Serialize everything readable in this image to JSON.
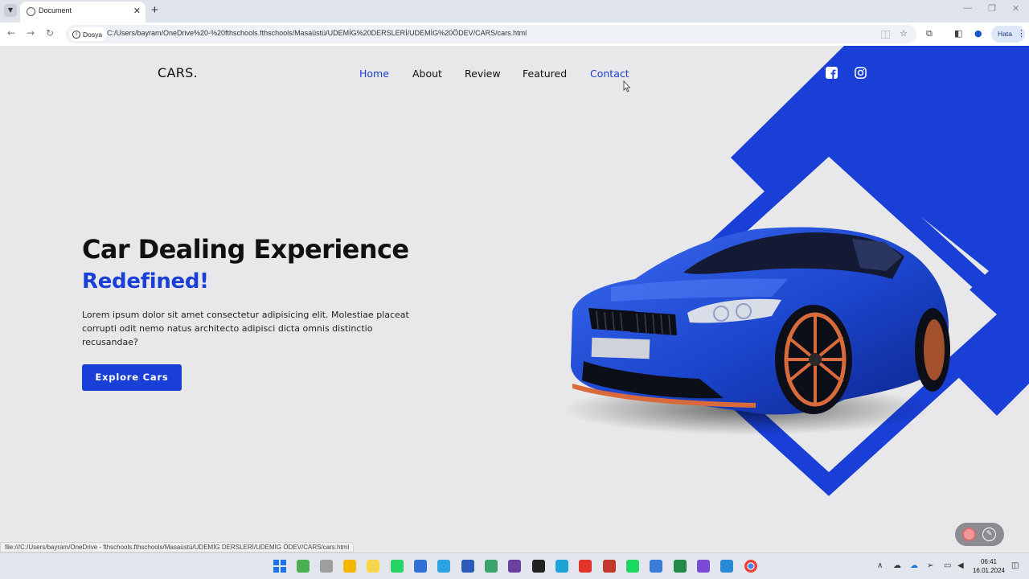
{
  "browser": {
    "tab_title": "Document",
    "site_info_label": "Dosya",
    "url": "C:/Users/bayram/OneDrive%20-%20fthschools.fthschools/Masaüstü/UDEMİG%20DERSLERİ/UDEMİG%20ÖDEV/CARS/cars.html",
    "profile_label": "Hata",
    "status_url": "file:///C:/Users/bayram/OneDrive - fthschools.fthschools/Masaüstü/UDEMİG DERSLERİ/UDEMİG ÖDEV/CARS/cars.html"
  },
  "site": {
    "logo": "CARS.",
    "nav": [
      {
        "label": "Home",
        "active": true
      },
      {
        "label": "About",
        "active": false
      },
      {
        "label": "Review",
        "active": false
      },
      {
        "label": "Featured",
        "active": false
      },
      {
        "label": "Contact",
        "active": true
      }
    ],
    "social_icons": [
      "facebook-icon",
      "instagram-icon"
    ],
    "hero": {
      "title": "Car Dealing Experience",
      "accent": "Redefined!",
      "description": "Lorem ipsum dolor sit amet consectetur adipisicing elit. Molestiae placeat corrupti odit nemo natus architecto adipisci dicta omnis distinctio recusandae?",
      "cta_label": "Explore Cars"
    },
    "colors": {
      "accent": "#1a3fd6",
      "background": "#e8e8ea",
      "car_body": "#1f4bd0",
      "wheel": "#d96a3c"
    }
  },
  "taskbar": {
    "apps": [
      "windows-start-icon",
      "widgets-icon",
      "task-view-icon",
      "file-explorer-icon",
      "sticky-notes-icon",
      "whatsapp-icon",
      "notepad-icon",
      "telegram-icon",
      "word-icon",
      "paint-icon",
      "github-desktop-icon",
      "notion-icon",
      "edge-icon",
      "opera-icon",
      "git-icon",
      "spotify-icon",
      "video-player-icon",
      "excel-icon",
      "slack-icon",
      "vscode-icon",
      "chrome-icon"
    ],
    "time": "06:41",
    "date": "16.01.2024"
  }
}
